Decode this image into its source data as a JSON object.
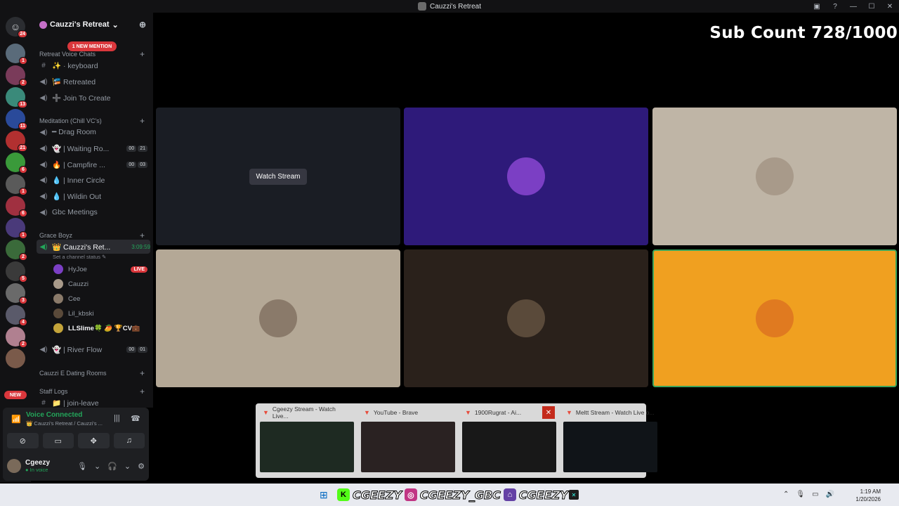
{
  "window": {
    "title": "Cauzzi's Retreat"
  },
  "server_rail": {
    "home_badge": "24",
    "servers": [
      {
        "badge": "1",
        "color": "#5a6b7a"
      },
      {
        "badge": "2",
        "color": "#7a3b5a"
      },
      {
        "badge": "13",
        "color": "#3a8a7a"
      },
      {
        "badge": "11",
        "color": "#2a4a9a"
      },
      {
        "badge": "21",
        "color": "#b23030"
      },
      {
        "badge": "6",
        "color": "#3a9a3a"
      },
      {
        "badge": "1",
        "color": "#5a5a5a"
      },
      {
        "badge": "6",
        "color": "#a03040"
      },
      {
        "badge": "1",
        "color": "#4a3a7a"
      },
      {
        "badge": "2",
        "color": "#3a6a3a"
      },
      {
        "badge": "5",
        "color": "#3a3a3a"
      },
      {
        "badge": "3",
        "color": "#6a6a6a"
      },
      {
        "badge": "4",
        "color": "#5a5a6a"
      },
      {
        "badge": "2",
        "color": "#b08090"
      },
      {
        "badge": "",
        "color": "#7a5a4a"
      }
    ],
    "new_label": "NEW"
  },
  "guild": {
    "name": "Cauzzi's Retreat"
  },
  "mention_pill": "1 NEW MENTION",
  "categories": {
    "retreat": "Retreat Voice Chats",
    "meditation": "Meditation (Chill VC's)",
    "grace": "Grace Boyz",
    "dating": "Cauzzi E Dating Rooms",
    "staff": "Staff Logs"
  },
  "channels": {
    "keyboard": "✨ · keyboard",
    "retreated": "🎏 Retreated",
    "join_create": "➕ Join To Create",
    "drag_room": "━ Drag Room",
    "waiting": "👻 | Waiting Ro...",
    "waiting_cnt": [
      "00",
      "21"
    ],
    "campfire": "🔥 | Campfire ...",
    "campfire_cnt": [
      "00",
      "03"
    ],
    "inner_circle": "💧 | Inner Circle",
    "wildin_out": "💧 | Wildin Out",
    "gbc_meetings": "Gbc Meetings",
    "cauzzi_retreat": "👑 Cauzzi's Ret...",
    "cauzzi_timer": "3:09:59",
    "channel_status": "Set a channel status ✎",
    "river_flow": "👻 | River Flow",
    "river_cnt": [
      "00",
      "01"
    ],
    "join_leave": "📁 | join-leave"
  },
  "voice_users": [
    {
      "name": "HyJoe",
      "live": "LIVE",
      "color": "#7b3fc4"
    },
    {
      "name": "Cauzzi",
      "live": "",
      "color": "#a89a8a"
    },
    {
      "name": "Cee",
      "live": "",
      "color": "#8a7a6a"
    },
    {
      "name": "Lil_kbski",
      "live": "",
      "color": "#5a4a3a"
    },
    {
      "name": "LLSlime🍀 🥭 🏆CV💼",
      "live": "",
      "color": "#c4a43a"
    }
  ],
  "voice_panel": {
    "status": "Voice Connected",
    "location": "👑 Cauzzi's Retreat / Cauzzi's ...",
    "username": "Cgeezy",
    "user_status": "● In voice"
  },
  "stream": {
    "sub_count": "Sub Count 728/1000",
    "watch_stream": "Watch Stream"
  },
  "tiles": [
    {
      "bg": "#1a1d24",
      "avatar": ""
    },
    {
      "bg": "#2e1a7a",
      "avatar": "#7b3fc4"
    },
    {
      "bg": "#bfb5a6",
      "avatar": "#a89a8a"
    },
    {
      "bg": "#b4a896",
      "avatar": "#8a7a6a"
    },
    {
      "bg": "#2a211b",
      "avatar": "#5a4a3a"
    },
    {
      "bg": "#f0a020",
      "avatar": "#e07a20"
    }
  ],
  "taskbar_previews": [
    {
      "title": "Cgeezy Stream - Watch Live...",
      "thumb": "#1e2a22"
    },
    {
      "title": "YouTube - Brave",
      "thumb": "#2a2222"
    },
    {
      "title": "1900Rugrat - Ai...",
      "thumb": "#181818",
      "close": "✕"
    },
    {
      "title": "Meltt Stream - Watch Live o...",
      "thumb": "#101418"
    }
  ],
  "taskbar": {
    "socials_kick": "CGEEZY",
    "socials_ig": "CGEEZY_GBC",
    "socials_twitch": "CGEEZY",
    "time": "1:19 AM",
    "date": "1/20/2026"
  }
}
